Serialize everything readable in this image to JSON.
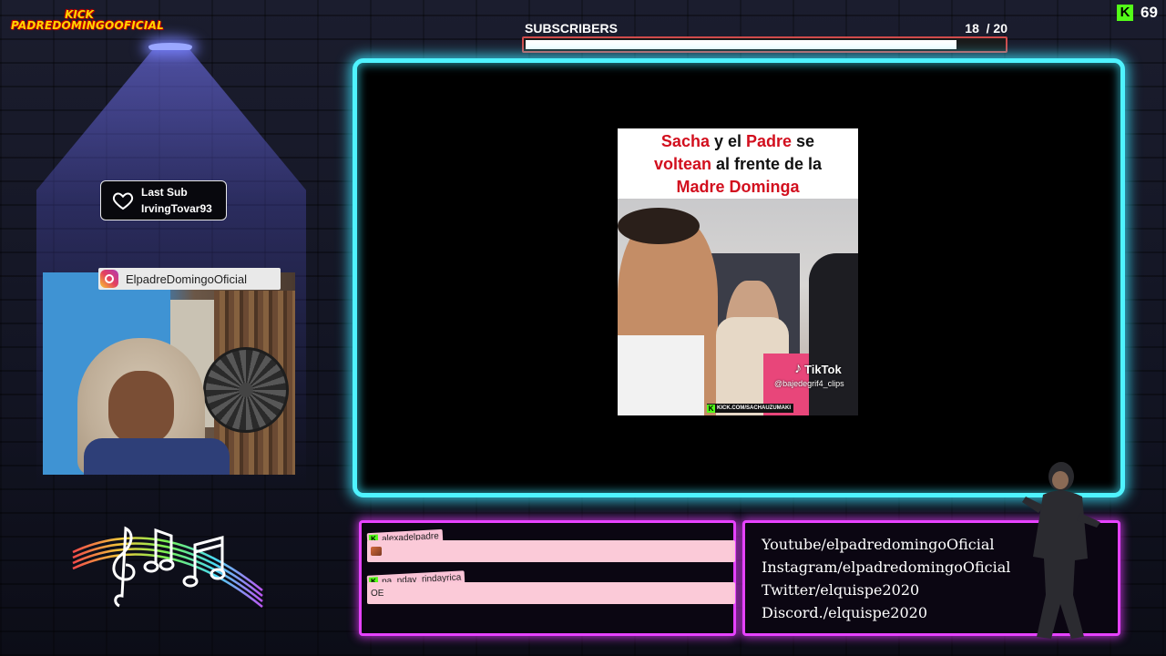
{
  "channel_tag": {
    "line1": "KICK",
    "line2": "PADREDOMINGOOFICIAL"
  },
  "last_sub": {
    "label": "Last Sub",
    "user": "IrvingTovar93",
    "icon": "heart-icon"
  },
  "webcam": {
    "handle": "ElpadreDomingoOficial",
    "icon": "instagram-icon"
  },
  "subscribers_goal": {
    "label": "SUBSCRIBERS",
    "current": "18",
    "target": "/ 20",
    "progress": 0.9
  },
  "kick": {
    "icon": "kick-logo-icon",
    "viewers": "69"
  },
  "video": {
    "caption_parts": [
      {
        "text": "Sacha",
        "red": true
      },
      {
        "text": " y el ",
        "red": false
      },
      {
        "text": "Padre",
        "red": true
      },
      {
        "text": " se",
        "red": false
      }
    ],
    "caption_line2": [
      {
        "text": "voltean",
        "red": true
      },
      {
        "text": " al frente de la",
        "red": false
      }
    ],
    "caption_line3": [
      {
        "text": "Madre Dominga",
        "red": true
      }
    ],
    "tiktok_label": "TikTok",
    "tiktok_handle": "@bajedegrif4_clips",
    "watermark": "KICK.COM/SACHAUZUMAKI"
  },
  "chat": {
    "messages": [
      {
        "user": "alexadelpadre",
        "text": "",
        "has_emote": true
      },
      {
        "user": "pa_nday_rindayrica",
        "text": "OE",
        "has_emote": false
      }
    ]
  },
  "socials": [
    "Youtube/elpadredomingoOficial",
    "Instagram/elpadredomingoOficial",
    "Twitter/elquispe2020",
    "Discord./elquispe2020"
  ],
  "colors": {
    "neon_cyan": "#4ff3ff",
    "neon_magenta": "#e642ff",
    "kick_green": "#53fc18",
    "caption_red": "#d20f1e"
  }
}
